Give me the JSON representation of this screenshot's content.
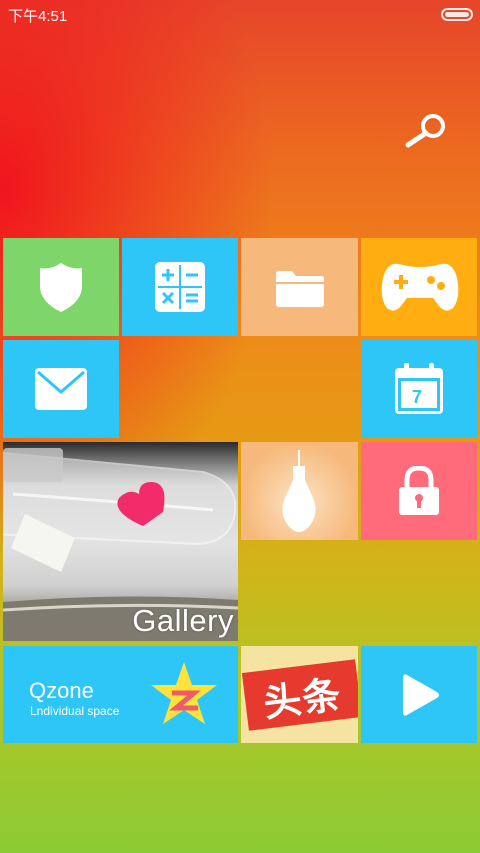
{
  "status_bar": {
    "time": "下午4:51"
  },
  "icons": {
    "search": "search-icon",
    "security": "shield-icon",
    "calculator": "calculator-icon",
    "files": "folder-icon",
    "games": "gamepad-icon",
    "mail": "mail-icon",
    "calendar": "calendar-icon",
    "flashlight": "lightbulb-icon",
    "lock": "lock-icon",
    "qzone": "qzone-star-icon",
    "video": "play-icon",
    "battery": "battery-icon"
  },
  "calendar": {
    "day": "7"
  },
  "gallery": {
    "label": "Gallery"
  },
  "qzone": {
    "title": "Qzone",
    "subtitle": "Lndividual space"
  },
  "toutiao": {
    "label": "头条"
  },
  "colors": {
    "green_tile": "#7ed66a",
    "blue_tile": "#2ec6f6",
    "peach_tile": "#f6b97b",
    "orange_tile": "#ffad10",
    "pink_tile": "#ff6b7b",
    "toutiao_red": "#e63a2e",
    "star_yellow": "#ffe23a"
  }
}
